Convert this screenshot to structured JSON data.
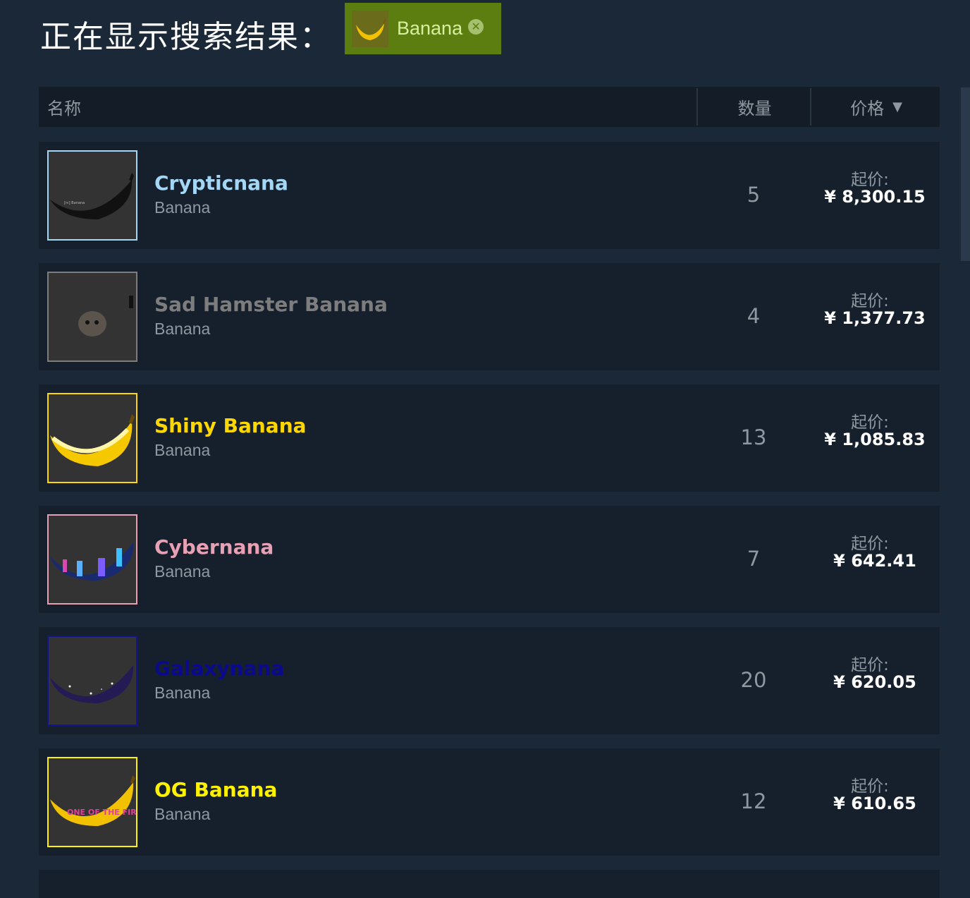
{
  "header": {
    "title": "正在显示搜索结果：",
    "filter_tag": {
      "label": "Banana",
      "icon": "banana-icon",
      "close_icon": "close-circle-icon"
    }
  },
  "table": {
    "columns": {
      "name": "名称",
      "quantity": "数量",
      "price": "价格"
    },
    "sort_indicator": "▼",
    "price_prefix": "起价:",
    "rows": [
      {
        "name": "Crypticnana",
        "game": "Banana",
        "quantity": "5",
        "price": "¥ 8,300.15",
        "name_color": "#a4d7f5",
        "border_color": "#a4d7f5"
      },
      {
        "name": "Sad Hamster Banana",
        "game": "Banana",
        "quantity": "4",
        "price": "¥ 1,377.73",
        "name_color": "#7d7d7d",
        "border_color": "#7d7d7d"
      },
      {
        "name": "Shiny Banana",
        "game": "Banana",
        "quantity": "13",
        "price": "¥ 1,085.83",
        "name_color": "#ffd700",
        "border_color": "#ffd700"
      },
      {
        "name": "Cybernana",
        "game": "Banana",
        "quantity": "7",
        "price": "¥ 642.41",
        "name_color": "#e8a0b4",
        "border_color": "#e8a0b4"
      },
      {
        "name": "Galaxynana",
        "game": "Banana",
        "quantity": "20",
        "price": "¥ 620.05",
        "name_color": "#0a0a8a",
        "border_color": "#14148c"
      },
      {
        "name": "OG Banana",
        "game": "Banana",
        "quantity": "12",
        "price": "¥ 610.65",
        "name_color": "#fff200",
        "border_color": "#fff200"
      }
    ]
  }
}
